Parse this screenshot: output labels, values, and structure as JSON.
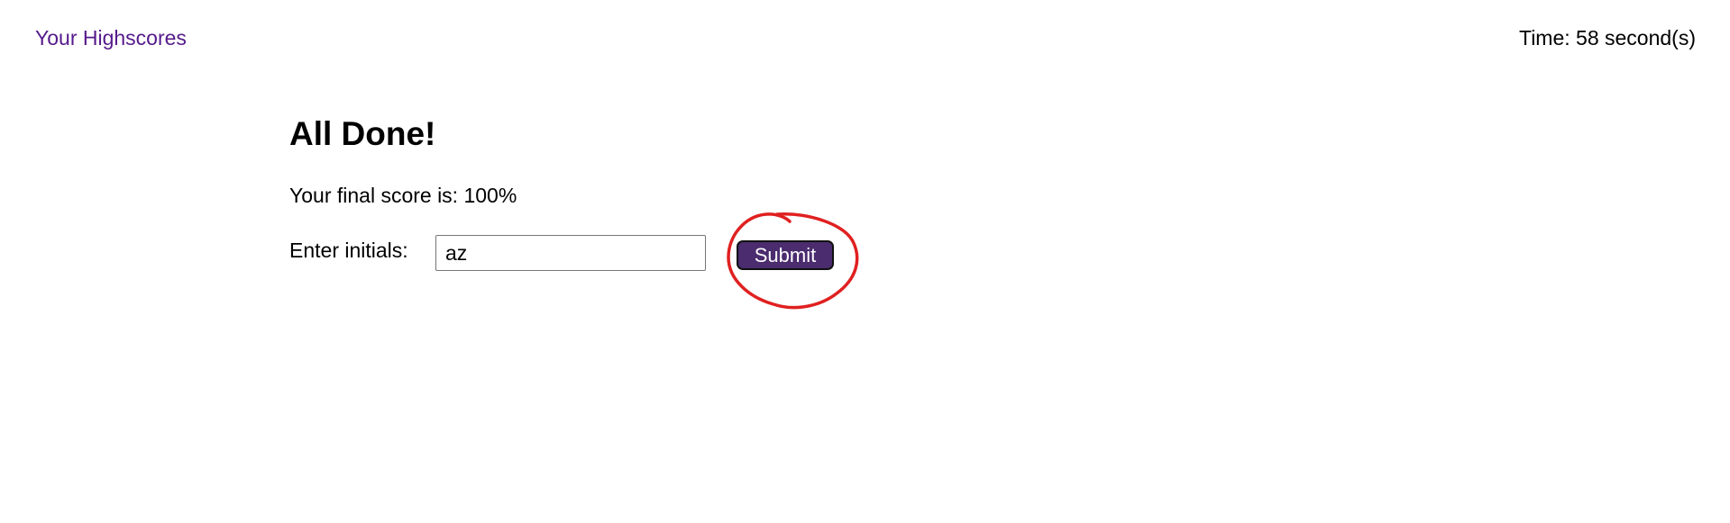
{
  "header": {
    "highscores_link": "Your Highscores",
    "timer_text": "Time: 58 second(s)"
  },
  "quiz_end": {
    "title": "All Done!",
    "score_text": "Your final score is: 100%",
    "initials_label": "Enter initials:",
    "initials_value": "az",
    "submit_label": "Submit"
  },
  "colors": {
    "link": "#551a8b",
    "button_bg": "#4b2c6e",
    "annotation": "#e02020"
  }
}
